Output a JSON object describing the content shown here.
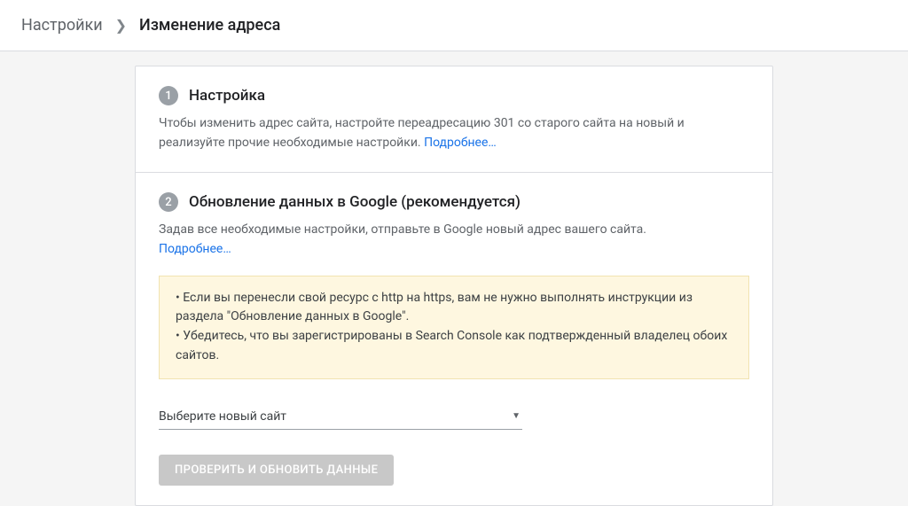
{
  "breadcrumb": {
    "root": "Настройки",
    "current": "Изменение адреса"
  },
  "step1": {
    "number": "1",
    "title": "Настройка",
    "desc_part1": "Чтобы изменить адрес сайта, настройте переадресацию 301 со старого сайта на новый и реализуйте прочие необходимые настройки. ",
    "learn_more": "Подробнее…"
  },
  "step2": {
    "number": "2",
    "title": "Обновление данных в Google (рекомендуется)",
    "desc_part1": "Задав все необходимые настройки, отправьте в Google новый адрес вашего сайта. ",
    "learn_more": "Подробнее…",
    "notice_bullet1": "• Если вы перенесли свой ресурс с http на https, вам не нужно выполнять инструкции из раздела \"Обновление данных в Google\".",
    "notice_bullet2": "• Убедитесь, что вы зарегистрированы в Search Console как подтвержденный владелец обоих сайтов.",
    "dropdown_label": "Выберите новый сайт",
    "button_label": "ПРОВЕРИТЬ И ОБНОВИТЬ ДАННЫЕ"
  }
}
